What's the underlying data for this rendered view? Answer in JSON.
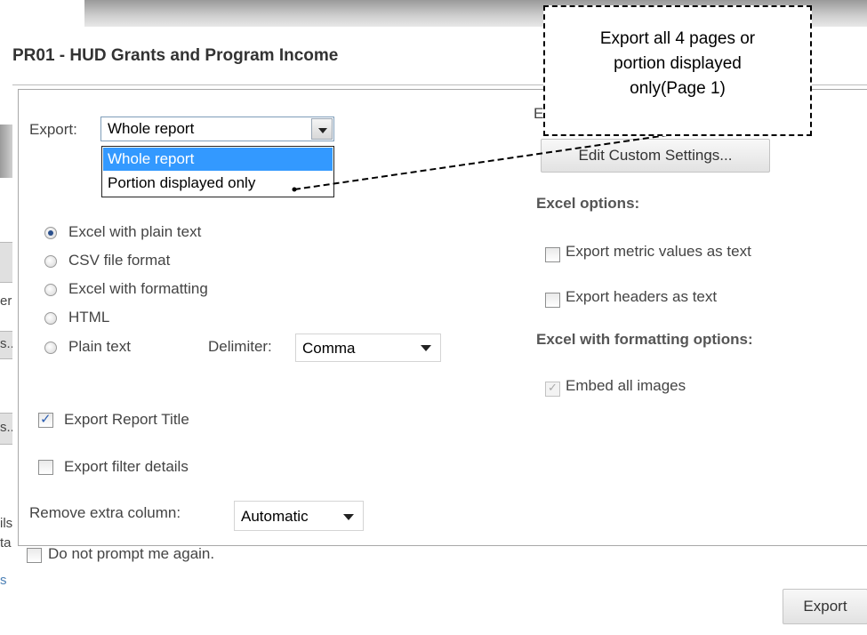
{
  "background": {
    "side_fragments": [
      "er",
      "s...",
      "s...",
      "ils",
      "ta",
      "s"
    ]
  },
  "dialog": {
    "title": "PR01 - HUD Grants and Program Income",
    "export": {
      "label": "Export:",
      "selected": "Whole report",
      "options": [
        "Whole report",
        "Portion displayed only"
      ],
      "highlighted_index": 0
    },
    "formats": [
      {
        "label": "Excel with plain text",
        "selected": true
      },
      {
        "label": "CSV file format",
        "selected": false
      },
      {
        "label": "Excel with formatting",
        "selected": false
      },
      {
        "label": "HTML",
        "selected": false
      },
      {
        "label": "Plain text",
        "selected": false
      }
    ],
    "delimiter": {
      "label": "Delimiter:",
      "value": "Comma"
    },
    "export_report_title": {
      "label": "Export Report Title",
      "checked": true
    },
    "export_filter_details": {
      "label": "Export filter details",
      "checked": false
    },
    "remove_extra_column": {
      "label": "Remove extra column:",
      "value": "Automatic"
    },
    "right": {
      "partial_label": "E",
      "edit_custom_button": "Edit Custom Settings...",
      "excel_options_heading": "Excel options:",
      "metric_values": {
        "label": "Export metric values as text",
        "checked": false
      },
      "headers_text": {
        "label": "Export headers as text",
        "checked": false
      },
      "excel_formatting_heading": "Excel with formatting options:",
      "embed_images": {
        "label": "Embed all images",
        "checked": true,
        "disabled": true
      }
    },
    "do_not_prompt": {
      "label": "Do not prompt me again.",
      "checked": false
    },
    "export_button": "Export"
  },
  "callout": {
    "text": "Export all 4 pages or\nportion displayed\nonly(Page 1)"
  },
  "colors": {
    "highlight": "#3399ff",
    "title": "#333333",
    "link": "#4a7fb5"
  }
}
